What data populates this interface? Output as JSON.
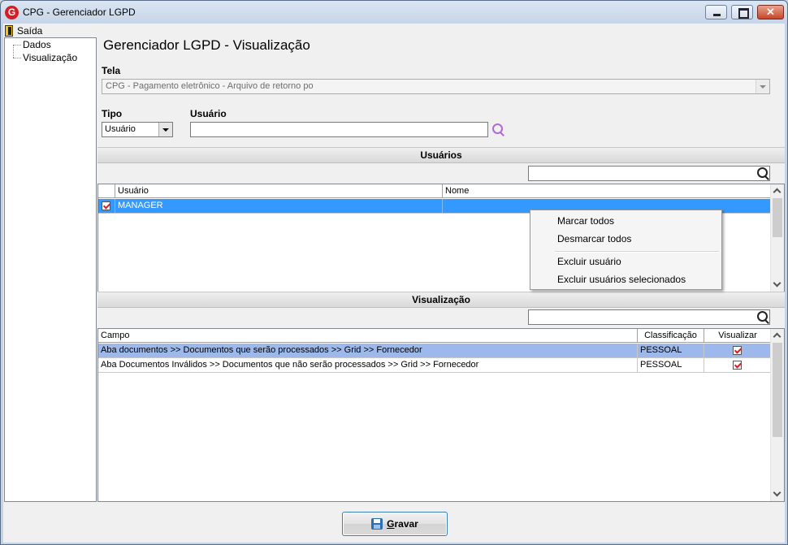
{
  "window": {
    "app_icon_letter": "G",
    "title": "CPG - Gerenciador LGPD"
  },
  "menu": {
    "exit_label": "Saída"
  },
  "tree": {
    "items": [
      "Dados",
      "Visualização"
    ]
  },
  "page": {
    "title": "Gerenciador LGPD - Visualização"
  },
  "form": {
    "tela_label": "Tela",
    "tela_value": "CPG - Pagamento eletrônico - Arquivo de retorno po",
    "tipo_label": "Tipo",
    "tipo_value": "Usuário",
    "usuario_label": "Usuário",
    "usuario_value": ""
  },
  "usuarios": {
    "header": "Usuários",
    "filter_value": "",
    "columns": [
      "Usuário",
      "Nome"
    ],
    "rows": [
      {
        "usuario": "MANAGER",
        "nome": "",
        "checked": true
      }
    ]
  },
  "context_menu": {
    "items": [
      "Marcar todos",
      "Desmarcar todos",
      "Excluir usuário",
      "Excluir usuários selecionados"
    ]
  },
  "visualizacao": {
    "header": "Visualização",
    "filter_value": "",
    "columns": [
      "Campo",
      "Classificação",
      "Visualizar"
    ],
    "rows": [
      {
        "campo": "Aba documentos >> Documentos que serão processados >> Grid >> Fornecedor",
        "classificacao": "PESSOAL",
        "visualizar": true
      },
      {
        "campo": "Aba Documentos Inválidos >> Documentos que não serão processados >> Grid >> Fornecedor",
        "classificacao": "PESSOAL",
        "visualizar": true
      }
    ]
  },
  "footer": {
    "save_label": "Gravar"
  },
  "colors": {
    "selection": "#3399ff",
    "selection_light": "#9db9eb",
    "brand_red": "#d21f26"
  }
}
